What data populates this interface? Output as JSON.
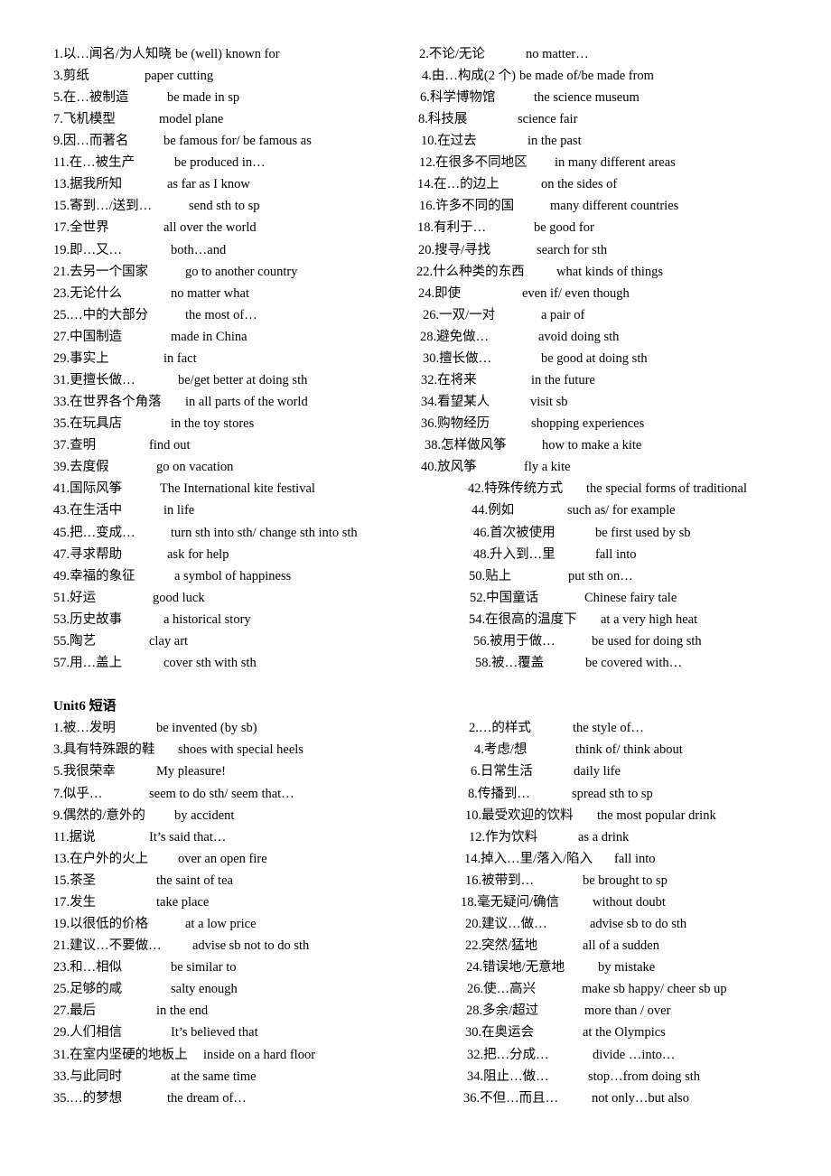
{
  "unit5": {
    "entries": [
      {
        "cn": "1.以…闻名/为人知晓",
        "en": "be (well) known for"
      },
      {
        "cn": "2.不论/无论",
        "en": "no matter…"
      },
      {
        "cn": "3.剪纸",
        "en": "paper cutting"
      },
      {
        "cn": "4.由…构成(2 个)",
        "en": "be made of/be made from"
      },
      {
        "cn": "5.在…被制造",
        "en": "be made in sp"
      },
      {
        "cn": "6.科学博物馆",
        "en": "the science museum"
      },
      {
        "cn": "7.飞机模型",
        "en": "model plane"
      },
      {
        "cn": "8.科技展",
        "en": "science fair"
      },
      {
        "cn": "9.因…而著名",
        "en": "be famous for/ be famous as"
      },
      {
        "cn": "10.在过去",
        "en": "in the past"
      },
      {
        "cn": "11.在…被生产",
        "en": "be produced in…"
      },
      {
        "cn": "12.在很多不同地区",
        "en": "in many different areas"
      },
      {
        "cn": "13.据我所知",
        "en": "as far as I know"
      },
      {
        "cn": "14.在…的边上",
        "en": "on the sides of"
      },
      {
        "cn": "15.寄到…/送到…",
        "en": "send sth to sp"
      },
      {
        "cn": "16.许多不同的国",
        "en": "many different countries"
      },
      {
        "cn": "17.全世界",
        "en": "all over the world"
      },
      {
        "cn": "18.有利于…",
        "en": "be good for"
      },
      {
        "cn": "19.即…又…",
        "en": "both…and"
      },
      {
        "cn": "20.搜寻/寻找",
        "en": "search for sth"
      },
      {
        "cn": "21.去另一个国家",
        "en": "go to another country"
      },
      {
        "cn": "22.什么种类的东西",
        "en": "what kinds of things"
      },
      {
        "cn": "23.无论什么",
        "en": "no matter what"
      },
      {
        "cn": "24.即使",
        "en": "even if/ even though"
      },
      {
        "cn": "25.…中的大部分",
        "en": "the most of…"
      },
      {
        "cn": "26.一双/一对",
        "en": "a pair of"
      },
      {
        "cn": "27.中国制造",
        "en": "made in China"
      },
      {
        "cn": "28.避免做…",
        "en": "avoid doing sth"
      },
      {
        "cn": "29.事实上",
        "en": "in fact"
      },
      {
        "cn": "30.擅长做…",
        "en": "be good at doing sth"
      },
      {
        "cn": "31.更擅长做…",
        "en": "be/get better at doing sth"
      },
      {
        "cn": "32.在将来",
        "en": "in the future"
      },
      {
        "cn": "33.在世界各个角落",
        "en": "in all parts of the world"
      },
      {
        "cn": "34.看望某人",
        "en": "visit sb"
      },
      {
        "cn": "35.在玩具店",
        "en": "in the toy stores"
      },
      {
        "cn": "36.购物经历",
        "en": "shopping experiences"
      },
      {
        "cn": "37.查明",
        "en": "find out"
      },
      {
        "cn": "38.怎样做风筝",
        "en": "how to make a kite"
      },
      {
        "cn": "39.去度假",
        "en": "go on vacation"
      },
      {
        "cn": "40.放风筝",
        "en": "fly a kite"
      },
      {
        "cn": "41.国际风筝",
        "en": "The International kite festival"
      },
      {
        "cn": "42.特殊传统方式",
        "en": "the special forms of traditional"
      },
      {
        "cn": "43.在生活中",
        "en": "in life"
      },
      {
        "cn": "44.例如",
        "en": "such as/ for example"
      },
      {
        "cn": "45.把…变成…",
        "en": "turn sth into sth/  change sth into sth"
      },
      {
        "cn": "46.首次被使用",
        "en": "be first used by sb"
      },
      {
        "cn": "47.寻求帮助",
        "en": "ask for help"
      },
      {
        "cn": "48.升入到…里",
        "en": "fall into"
      },
      {
        "cn": "49.幸福的象征",
        "en": "a symbol of happiness"
      },
      {
        "cn": "50.贴上",
        "en": "put sth on…"
      },
      {
        "cn": "51.好运",
        "en": "good luck"
      },
      {
        "cn": "52.中国童话",
        "en": "Chinese fairy tale"
      },
      {
        "cn": "53.历史故事",
        "en": "a historical story"
      },
      {
        "cn": "54.在很高的温度下",
        "en": "at a very high heat"
      },
      {
        "cn": "55.陶艺",
        "en": "clay art"
      },
      {
        "cn": "56.被用于做…",
        "en": "be used for doing sth"
      },
      {
        "cn": "57.用…盖上",
        "en": "cover sth with sth"
      },
      {
        "cn": "58.被…覆盖",
        "en": "be covered with…"
      }
    ]
  },
  "unit6": {
    "heading": "Unit6 短语",
    "entries": [
      {
        "cn": "1.被…发明",
        "en": "be invented (by sb)"
      },
      {
        "cn": "2.…的样式",
        "en": "the style of…"
      },
      {
        "cn": "3.具有特殊跟的鞋",
        "en": "shoes with special heels"
      },
      {
        "cn": "4.考虑/想",
        "en": "think of/ think about"
      },
      {
        "cn": "5.我很荣幸",
        "en": "My pleasure!"
      },
      {
        "cn": "6.日常生活",
        "en": "daily life"
      },
      {
        "cn": "7.似乎…",
        "en": "seem to do sth/ seem that…"
      },
      {
        "cn": "8.传播到…",
        "en": "spread sth to sp"
      },
      {
        "cn": "9.偶然的/意外的",
        "en": "by accident"
      },
      {
        "cn": "10.最受欢迎的饮料",
        "en": "the most popular drink"
      },
      {
        "cn": "11.据说",
        "en": "It’s said that…"
      },
      {
        "cn": "12.作为饮料",
        "en": "as a drink"
      },
      {
        "cn": "13.在户外的火上",
        "en": "over an open fire"
      },
      {
        "cn": "14.掉入…里/落入/陷入",
        "en": "fall into"
      },
      {
        "cn": "15.茶圣",
        "en": "the saint of tea"
      },
      {
        "cn": "16.被带到…",
        "en": "be brought to sp"
      },
      {
        "cn": "17.发生",
        "en": "take place"
      },
      {
        "cn": "18.毫无疑问/确信",
        "en": "without doubt"
      },
      {
        "cn": "19.以很低的价格",
        "en": "at a low price"
      },
      {
        "cn": "20.建议…做…",
        "en": "advise sb to do sth"
      },
      {
        "cn": "21.建议…不要做…",
        "en": "advise sb not to do sth"
      },
      {
        "cn": "22.突然/猛地",
        "en": "all of a sudden"
      },
      {
        "cn": "23.和…相似",
        "en": "be similar to"
      },
      {
        "cn": "24.错误地/无意地",
        "en": "by mistake"
      },
      {
        "cn": "25.足够的咸",
        "en": "salty enough"
      },
      {
        "cn": "26.使…高兴",
        "en": "make sb happy/ cheer sb up"
      },
      {
        "cn": "27.最后",
        "en": "in the end"
      },
      {
        "cn": "28.多余/超过",
        "en": "more than / over"
      },
      {
        "cn": "29.人们相信",
        "en": "It’s believed that"
      },
      {
        "cn": "30.在奥运会",
        "en": "at the Olympics"
      },
      {
        "cn": "31.在室内坚硬的地板上",
        "en": "inside on a hard floor"
      },
      {
        "cn": "32.把…分成…",
        "en": "divide …into…"
      },
      {
        "cn": "33.与此同时",
        "en": "at the same time"
      },
      {
        "cn": "34.阻止…做…",
        "en": "stop…from doing sth"
      },
      {
        "cn": "35.…的梦想",
        "en": "the dream of…"
      },
      {
        "cn": "36.不但…而且…",
        "en": "not only…but also"
      }
    ]
  }
}
